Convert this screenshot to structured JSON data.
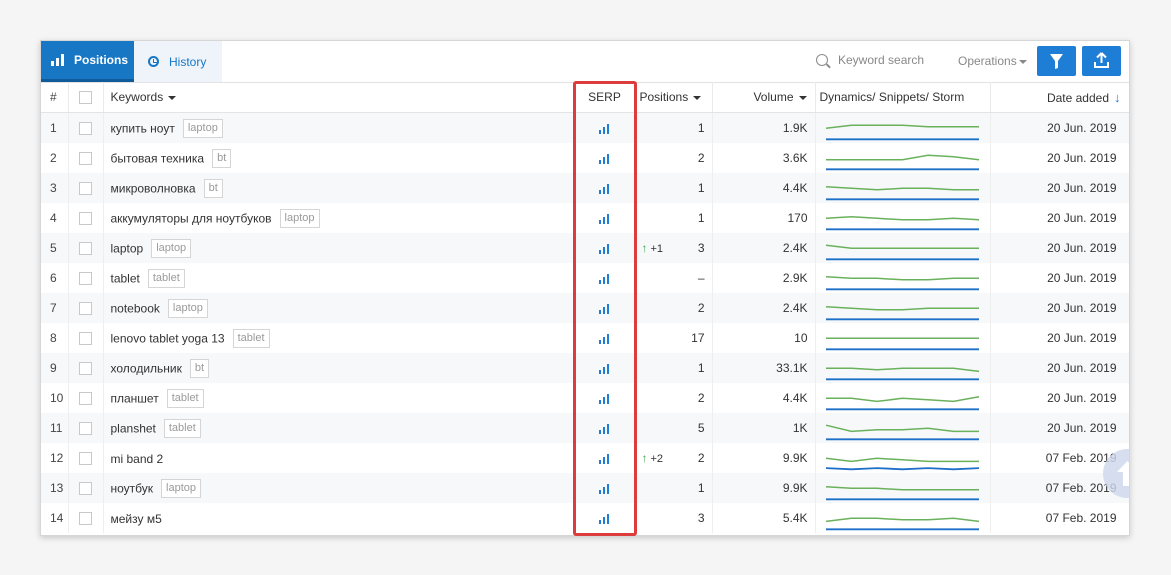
{
  "tabs": [
    {
      "label": "Positions",
      "active": true,
      "icon": "bar-chart-icon"
    },
    {
      "label": "History",
      "active": false,
      "icon": "clock-icon"
    }
  ],
  "search": {
    "placeholder": "Keyword search",
    "icon": "search-icon"
  },
  "operations_label": "Operations",
  "buttons": {
    "filter_icon": "filter-icon",
    "export_icon": "upload-icon"
  },
  "columns": {
    "num": "#",
    "keywords": "Keywords",
    "serp": "SERP",
    "positions": "Positions",
    "volume": "Volume",
    "dynamics": "Dynamics/ Snippets/ Storm",
    "date": "Date added"
  },
  "colors": {
    "accent": "#1877c5",
    "green_line": "#6ab15b",
    "blue_line": "#1e6fc8",
    "highlight": "#dc3c3c"
  },
  "rows": [
    {
      "num": "1",
      "keyword": "купить ноут",
      "tag": "laptop",
      "change": "",
      "position": "1",
      "volume": "1.9K",
      "date": "20 Jun. 2019"
    },
    {
      "num": "2",
      "keyword": "бытовая техника",
      "tag": "bt",
      "change": "",
      "position": "2",
      "volume": "3.6K",
      "date": "20 Jun. 2019"
    },
    {
      "num": "3",
      "keyword": "микроволновка",
      "tag": "bt",
      "change": "",
      "position": "1",
      "volume": "4.4K",
      "date": "20 Jun. 2019"
    },
    {
      "num": "4",
      "keyword": "аккумуляторы для ноутбуков",
      "tag": "laptop",
      "change": "",
      "position": "1",
      "volume": "170",
      "date": "20 Jun. 2019"
    },
    {
      "num": "5",
      "keyword": "laptop",
      "tag": "laptop",
      "change": "+1",
      "position": "3",
      "volume": "2.4K",
      "date": "20 Jun. 2019"
    },
    {
      "num": "6",
      "keyword": "tablet",
      "tag": "tablet",
      "change": "",
      "position": "–",
      "volume": "2.9K",
      "date": "20 Jun. 2019"
    },
    {
      "num": "7",
      "keyword": "notebook",
      "tag": "laptop",
      "change": "",
      "position": "2",
      "volume": "2.4K",
      "date": "20 Jun. 2019"
    },
    {
      "num": "8",
      "keyword": "lenovo tablet yoga 13",
      "tag": "tablet",
      "change": "",
      "position": "17",
      "volume": "10",
      "date": "20 Jun. 2019"
    },
    {
      "num": "9",
      "keyword": "холодильник",
      "tag": "bt",
      "change": "",
      "position": "1",
      "volume": "33.1K",
      "date": "20 Jun. 2019"
    },
    {
      "num": "10",
      "keyword": "планшет",
      "tag": "tablet",
      "change": "",
      "position": "2",
      "volume": "4.4K",
      "date": "20 Jun. 2019"
    },
    {
      "num": "11",
      "keyword": "planshet",
      "tag": "tablet",
      "change": "",
      "position": "5",
      "volume": "1K",
      "date": "20 Jun. 2019"
    },
    {
      "num": "12",
      "keyword": "mi band 2",
      "tag": "",
      "change": "+2",
      "position": "2",
      "volume": "9.9K",
      "date": "07 Feb. 2019"
    },
    {
      "num": "13",
      "keyword": "ноутбук",
      "tag": "laptop",
      "change": "",
      "position": "1",
      "volume": "9.9K",
      "date": "07 Feb. 2019"
    },
    {
      "num": "14",
      "keyword": "мейзу м5",
      "tag": "",
      "change": "",
      "position": "3",
      "volume": "5.4K",
      "date": "07 Feb. 2019"
    }
  ],
  "sparklines": [
    {
      "green": [
        5,
        7,
        7,
        7,
        6,
        6,
        6
      ],
      "blue": [
        1,
        1,
        1,
        1,
        1,
        1,
        1
      ]
    },
    {
      "green": [
        4,
        4,
        4,
        4,
        7,
        6,
        4
      ],
      "blue": [
        1,
        1,
        1,
        1,
        1,
        1,
        1
      ]
    },
    {
      "green": [
        6,
        5,
        4,
        5,
        5,
        4,
        4
      ],
      "blue": [
        1,
        1,
        1,
        1,
        1,
        1,
        1
      ]
    },
    {
      "green": [
        5,
        6,
        5,
        4,
        4,
        5,
        4
      ],
      "blue": [
        1,
        1,
        1,
        1,
        1,
        1,
        1
      ]
    },
    {
      "green": [
        7,
        5,
        5,
        5,
        5,
        5,
        5
      ],
      "blue": [
        1,
        1,
        1,
        1,
        1,
        1,
        1
      ]
    },
    {
      "green": [
        6,
        5,
        5,
        4,
        4,
        5,
        5
      ],
      "blue": [
        1,
        1,
        1,
        1,
        1,
        1,
        1
      ]
    },
    {
      "green": [
        6,
        5,
        4,
        4,
        5,
        5,
        5
      ],
      "blue": [
        1,
        1,
        1,
        1,
        1,
        1,
        1
      ]
    },
    {
      "green": [
        5,
        5,
        5,
        5,
        5,
        5,
        5
      ],
      "blue": [
        1,
        1,
        1,
        1,
        1,
        1,
        1
      ]
    },
    {
      "green": [
        5,
        5,
        4,
        5,
        5,
        5,
        3
      ],
      "blue": [
        1,
        1,
        1,
        1,
        1,
        1,
        1
      ]
    },
    {
      "green": [
        5,
        5,
        3,
        5,
        4,
        3,
        6
      ],
      "blue": [
        1,
        1,
        1,
        1,
        1,
        1,
        1
      ]
    },
    {
      "green": [
        7,
        3,
        4,
        4,
        5,
        3,
        3
      ],
      "blue": [
        1,
        1,
        1,
        1,
        1,
        1,
        1
      ]
    },
    {
      "green": [
        5,
        3,
        5,
        4,
        3,
        3,
        3
      ],
      "blue": [
        2,
        1,
        2,
        1,
        2,
        1,
        2
      ]
    },
    {
      "green": [
        6,
        5,
        5,
        4,
        4,
        4,
        4
      ],
      "blue": [
        1,
        1,
        1,
        1,
        1,
        1,
        1
      ]
    },
    {
      "green": [
        3,
        5,
        5,
        4,
        4,
        5,
        3
      ],
      "blue": [
        1,
        1,
        1,
        1,
        1,
        1,
        1
      ]
    }
  ]
}
